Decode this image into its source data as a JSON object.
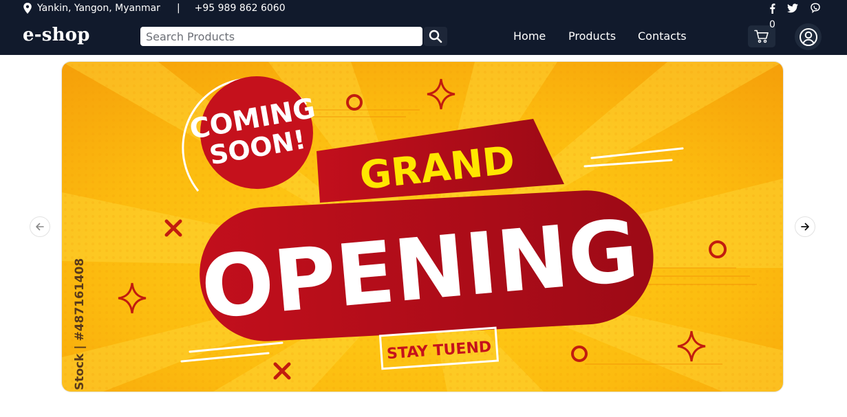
{
  "topbar": {
    "location": "Yankin, Yangon, Myanmar",
    "separator": "|",
    "phone": "+95 989 862 6060",
    "social_icons": [
      "facebook-icon",
      "twitter-icon",
      "viber-icon"
    ]
  },
  "header": {
    "brand": "e-shop",
    "search": {
      "placeholder": "Search Products",
      "value": ""
    },
    "nav": [
      "Home",
      "Products",
      "Contacts"
    ],
    "cart_count": "0"
  },
  "banner": {
    "badge_line1": "COMING",
    "badge_line2": "SOON!",
    "headline_top": "GRAND",
    "headline_main": "OPENING",
    "tagline": "STAY TUEND",
    "watermark": "Stock | #487161408"
  },
  "colors": {
    "header_bg": "#111a2c",
    "banner_yellow": "#fbb40e",
    "banner_red": "#c8101e",
    "accent_yellow": "#ffe600"
  }
}
